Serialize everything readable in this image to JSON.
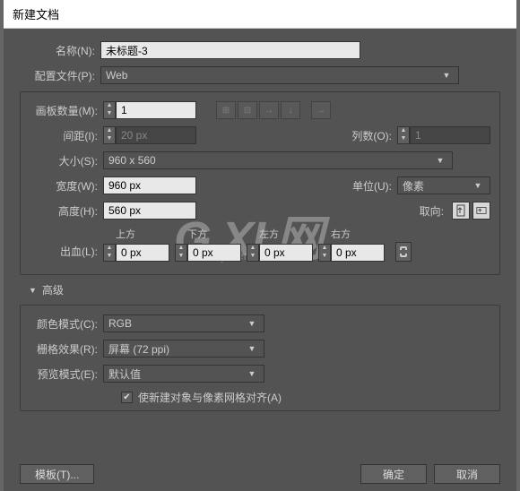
{
  "title": "新建文档",
  "name": {
    "label": "名称(N):",
    "value": "未标题-3"
  },
  "profile": {
    "label": "配置文件(P):",
    "value": "Web"
  },
  "artboards": {
    "count": {
      "label": "画板数量(M):",
      "value": "1"
    },
    "spacing": {
      "label": "间距(I):",
      "value": "20 px"
    },
    "columns": {
      "label": "列数(O):",
      "value": "1"
    }
  },
  "size": {
    "label": "大小(S):",
    "value": "960 x 560"
  },
  "width": {
    "label": "宽度(W):",
    "value": "960 px"
  },
  "height": {
    "label": "高度(H):",
    "value": "560 px"
  },
  "units": {
    "label": "单位(U):",
    "value": "像素"
  },
  "orientation": {
    "label": "取向:"
  },
  "bleed": {
    "label": "出血(L):",
    "top": {
      "hdr": "上方",
      "value": "0 px"
    },
    "bottom": {
      "hdr": "下方",
      "value": "0 px"
    },
    "left": {
      "hdr": "左方",
      "value": "0 px"
    },
    "right": {
      "hdr": "右方",
      "value": "0 px"
    }
  },
  "advanced": {
    "header": "高级",
    "colorMode": {
      "label": "颜色模式(C):",
      "value": "RGB"
    },
    "raster": {
      "label": "栅格效果(R):",
      "value": "屏幕 (72 ppi)"
    },
    "preview": {
      "label": "预览模式(E):",
      "value": "默认值"
    },
    "alignGrid": {
      "label": "使新建对象与像素网格对齐(A)",
      "checked": true
    }
  },
  "footer": {
    "templates": "模板(T)...",
    "ok": "确定",
    "cancel": "取消"
  },
  "watermark": {
    "main": "G XI 网",
    "sub": "system.com"
  }
}
